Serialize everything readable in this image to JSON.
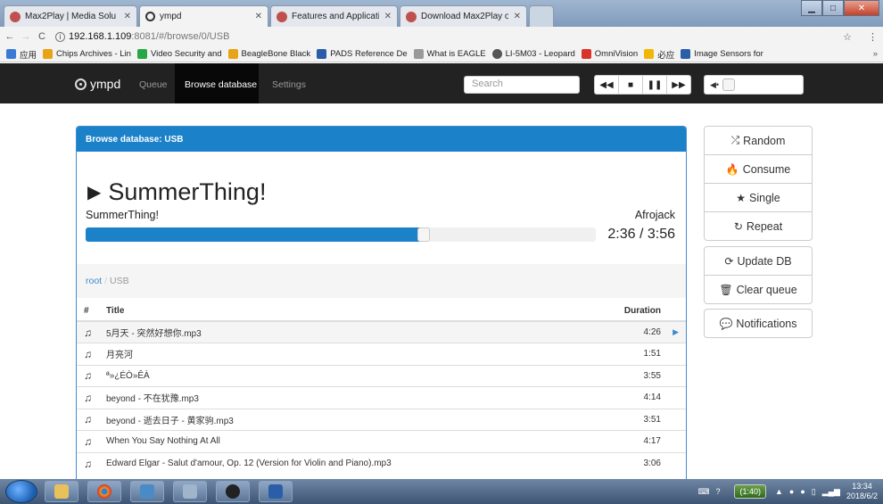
{
  "browser": {
    "tabs": [
      {
        "label": "Max2Play | Media Solu",
        "active": false,
        "icon": "max2play-icon",
        "color": "#c0504d"
      },
      {
        "label": "ympd",
        "active": true,
        "icon": "ympd-icon",
        "color": "#333333"
      },
      {
        "label": "Features and Applicati",
        "active": false,
        "icon": "max2play-icon",
        "color": "#c0504d"
      },
      {
        "label": "Download Max2Play o",
        "active": false,
        "icon": "max2play-icon",
        "color": "#c0504d"
      }
    ],
    "url_host": "192.168.1.109",
    "url_path": ":8081/#/browse/0/USB",
    "bookmarks": [
      {
        "label": "应用",
        "color": "#3b7bd6"
      },
      {
        "label": "Chips Archives - Lin",
        "color": "#e8a317"
      },
      {
        "label": "Video Security and",
        "color": "#27a745"
      },
      {
        "label": "BeagleBone Black",
        "color": "#e8a317"
      },
      {
        "label": "PADS Reference De",
        "color": "#2b5ea8"
      },
      {
        "label": "What is EAGLE",
        "color": "#999999"
      },
      {
        "label": "LI-5M03 - Leopard",
        "color": "#555555"
      },
      {
        "label": "OmniVision",
        "color": "#d9342b"
      },
      {
        "label": "必应",
        "color": "#f2b705"
      },
      {
        "label": "Image Sensors for",
        "color": "#2b5ea8"
      }
    ]
  },
  "navbar": {
    "brand": "ympd",
    "links": [
      "Queue",
      "Browse database",
      "Settings"
    ],
    "search_placeholder": "Search",
    "player_buttons": [
      {
        "icon": "previous-icon",
        "glyph": "⏮"
      },
      {
        "icon": "stop-icon",
        "glyph": "■"
      },
      {
        "icon": "pause-icon",
        "glyph": "❚❚"
      },
      {
        "icon": "next-icon",
        "glyph": "⏭"
      }
    ],
    "volume_level": 0.0
  },
  "panel": {
    "heading": "Browse database: USB",
    "now_playing": {
      "title": "SummerThing!",
      "album": "SummerThing!",
      "artist": "Afrojack",
      "time": "2:36 / 3:56",
      "progress": 0.66
    },
    "breadcrumb": {
      "root": "root",
      "separator": "/",
      "current": "USB"
    },
    "columns": {
      "num": "#",
      "title": "Title",
      "duration": "Duration"
    },
    "tracks": [
      {
        "title": "5月天 - 突然好想你.mp3",
        "duration": "4:26",
        "active": true
      },
      {
        "title": "月亮河",
        "duration": "1:51",
        "active": false
      },
      {
        "title": "ª»¿ÉÒ»ÊÀ",
        "duration": "3:55",
        "active": false
      },
      {
        "title": "beyond - 不在犹豫.mp3",
        "duration": "4:14",
        "active": false
      },
      {
        "title": "beyond - 逝去日子 - 黄家驹.mp3",
        "duration": "3:51",
        "active": false
      },
      {
        "title": "When You Say Nothing At All",
        "duration": "4:17",
        "active": false
      },
      {
        "title": "Edward Elgar - Salut d'amour, Op. 12 (Version for Violin and Piano).mp3",
        "duration": "3:06",
        "active": false
      }
    ]
  },
  "side_buttons": {
    "random": "Random",
    "consume": "Consume",
    "single": "Single",
    "repeat": "Repeat",
    "update_db": "Update DB",
    "clear_queue": "Clear queue",
    "notifications": "Notifications"
  },
  "taskbar": {
    "network_pill": "(1:40)",
    "clock_time": "13:34",
    "clock_date": "2018/6/2"
  },
  "colors": {
    "accent": "#1b81c9",
    "navbar": "#222222"
  }
}
